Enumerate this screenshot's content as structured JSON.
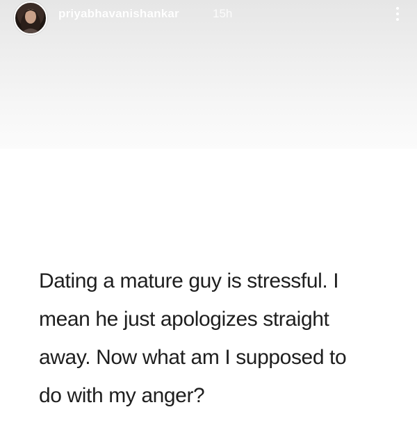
{
  "story": {
    "username": "priyabhavanishankar",
    "timestamp": "15h",
    "more_icon": "more-vertical-icon",
    "text": "Dating a mature guy is stressful. I\nmean he just apologizes straight\naway. Now what am I supposed to\ndo with my anger?"
  }
}
